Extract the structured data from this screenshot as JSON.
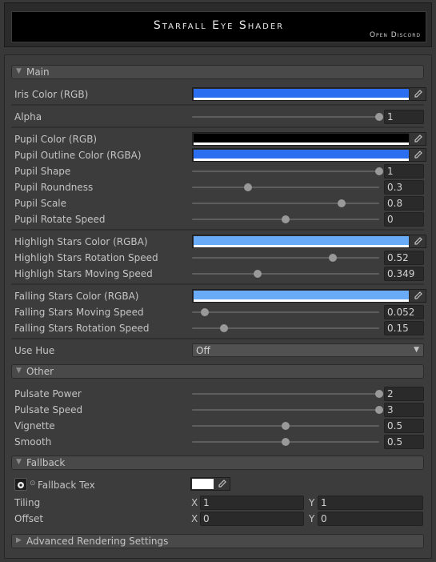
{
  "header": {
    "title": "Starfall Eye Shader",
    "link": "Open Discord"
  },
  "sections": {
    "main": "Main",
    "other": "Other",
    "fallback": "Fallback",
    "advanced": "Advanced Rendering Settings"
  },
  "props": {
    "iris_color": {
      "label": "Iris Color (RGB)",
      "color": "#2b6ff0"
    },
    "alpha": {
      "label": "Alpha",
      "value": "1",
      "fraction": 1.0
    },
    "pupil_color": {
      "label": "Pupil Color (RGB)",
      "color": "#000000"
    },
    "pupil_outline_color": {
      "label": "Pupil Outline Color (RGBA)",
      "color": "#2b6ff0"
    },
    "pupil_shape": {
      "label": "Pupil Shape",
      "value": "1",
      "fraction": 1.0
    },
    "pupil_roundness": {
      "label": "Pupil Roundness",
      "value": "0.3",
      "fraction": 0.3
    },
    "pupil_scale": {
      "label": "Pupil Scale",
      "value": "0.8",
      "fraction": 0.8
    },
    "pupil_rotate_speed": {
      "label": "Pupil Rotate Speed",
      "value": "0",
      "fraction": 0.5
    },
    "highlight_stars_color": {
      "label": "Highligh Stars Color (RGBA)",
      "color": "#6aabf7"
    },
    "highlight_stars_rotation_speed": {
      "label": "Highligh Stars Rotation Speed",
      "value": "0.52",
      "fraction": 0.75
    },
    "highlight_stars_moving_speed": {
      "label": "Highligh Stars Moving Speed",
      "value": "0.349",
      "fraction": 0.35
    },
    "falling_stars_color": {
      "label": "Falling Stars Color (RGBA)",
      "color": "#6aabf7"
    },
    "falling_stars_moving_speed": {
      "label": "Falling Stars Moving Speed",
      "value": "0.052",
      "fraction": 0.07
    },
    "falling_stars_rotation_speed": {
      "label": "Falling Stars Rotation Speed",
      "value": "0.15",
      "fraction": 0.17
    },
    "use_hue": {
      "label": "Use Hue",
      "value": "Off"
    },
    "pulsate_power": {
      "label": "Pulsate Power",
      "value": "2",
      "fraction": 1.0
    },
    "pulsate_speed": {
      "label": "Pulsate Speed",
      "value": "3",
      "fraction": 1.0
    },
    "vignette": {
      "label": "Vignette",
      "value": "0.5",
      "fraction": 0.5
    },
    "smooth": {
      "label": "Smooth",
      "value": "0.5",
      "fraction": 0.5
    },
    "fallback_tex": {
      "label": "Fallback Tex",
      "color": "#ffffff"
    },
    "tiling": {
      "label": "Tiling",
      "x_label": "X",
      "x": "1",
      "y_label": "Y",
      "y": "1"
    },
    "offset": {
      "label": "Offset",
      "x_label": "X",
      "x": "0",
      "y_label": "Y",
      "y": "0"
    }
  }
}
